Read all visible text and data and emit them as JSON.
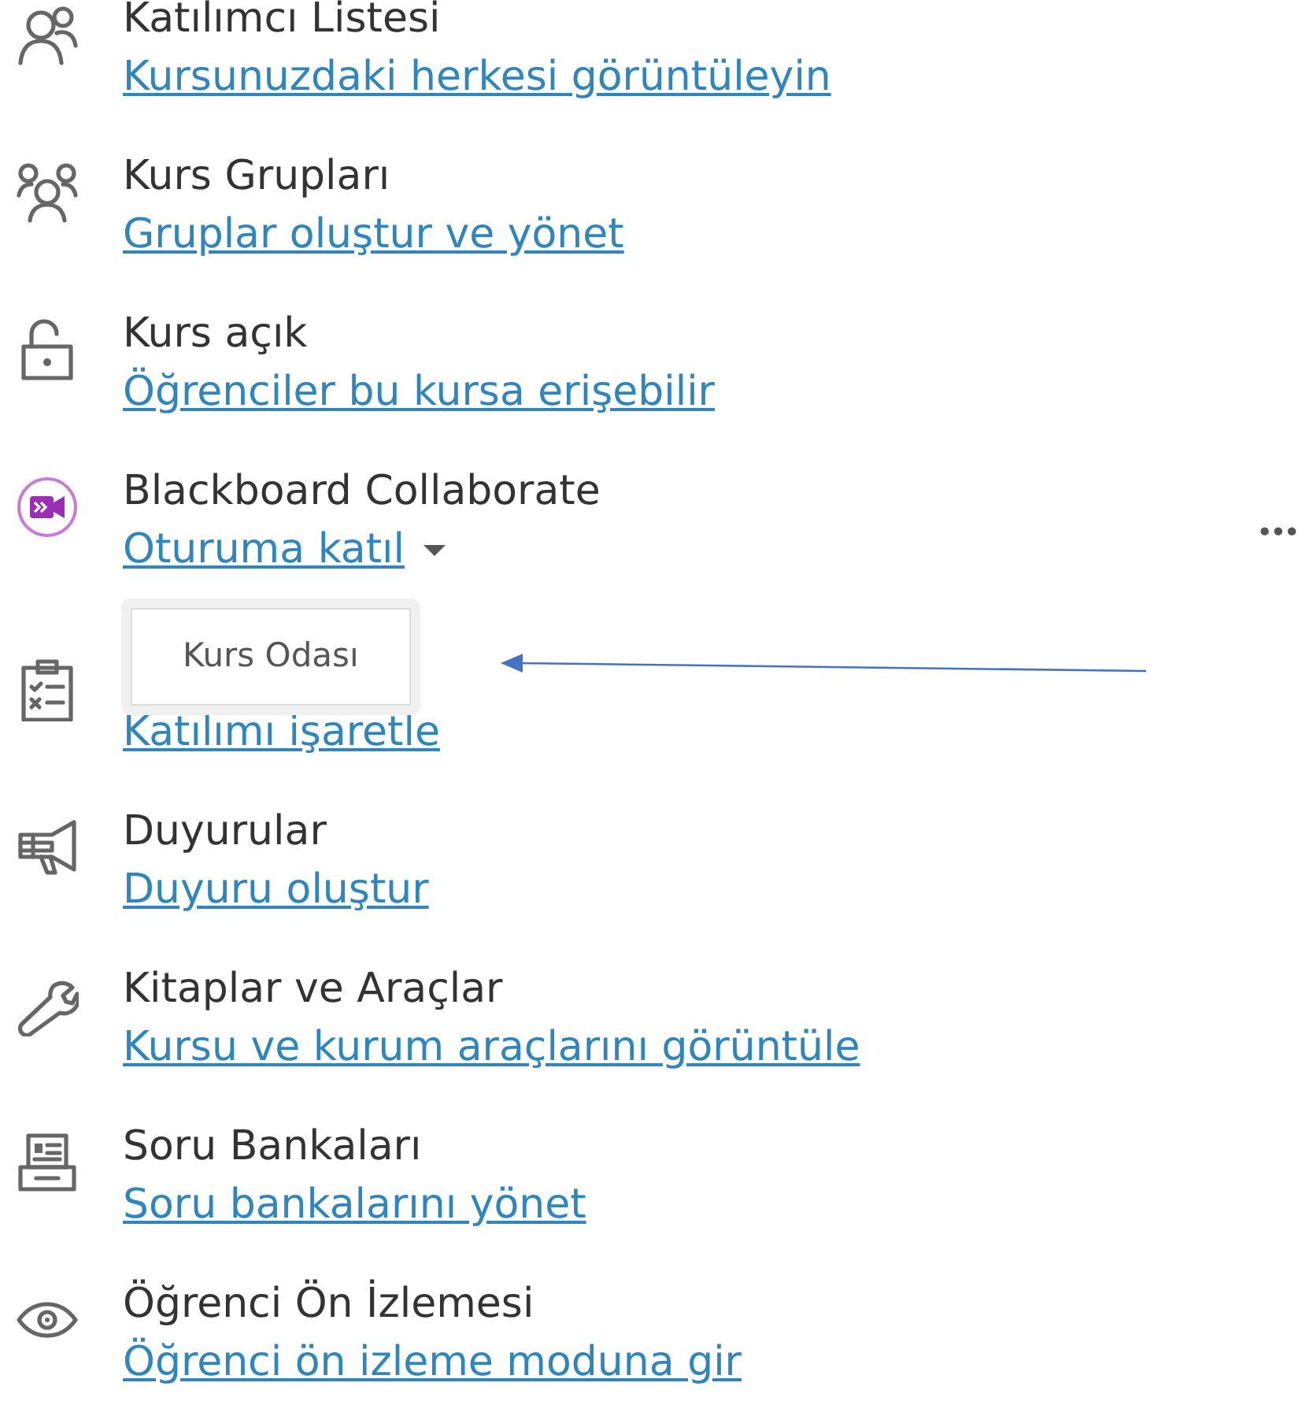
{
  "items": [
    {
      "kind": "roster",
      "title": "Katılımcı Listesi",
      "link": "Kursunuzdaki herkesi görüntüleyin"
    },
    {
      "kind": "groups",
      "title": "Kurs Grupları",
      "link": "Gruplar oluştur ve yönet"
    },
    {
      "kind": "lock",
      "title": "Kurs açık",
      "link": "Öğrenciler bu kursa erişebilir"
    },
    {
      "kind": "collaborate",
      "title": "Blackboard Collaborate",
      "link": "Oturuma katıl",
      "dropdown": {
        "expanded": true,
        "options": [
          "Kurs Odası"
        ]
      }
    },
    {
      "kind": "attendance",
      "link": "Katılımı işaretle"
    },
    {
      "kind": "announce",
      "title": "Duyurular",
      "link": "Duyuru oluştur"
    },
    {
      "kind": "tools",
      "title": "Kitaplar ve Araçlar",
      "link": "Kursu ve kurum araçlarını görüntüle"
    },
    {
      "kind": "bank",
      "title": "Soru Bankaları",
      "link": "Soru bankalarını yönet"
    },
    {
      "kind": "preview",
      "title": "Öğrenci Ön İzlemesi",
      "link": "Öğrenci ön izleme moduna gir"
    }
  ],
  "more_menu": "•••"
}
